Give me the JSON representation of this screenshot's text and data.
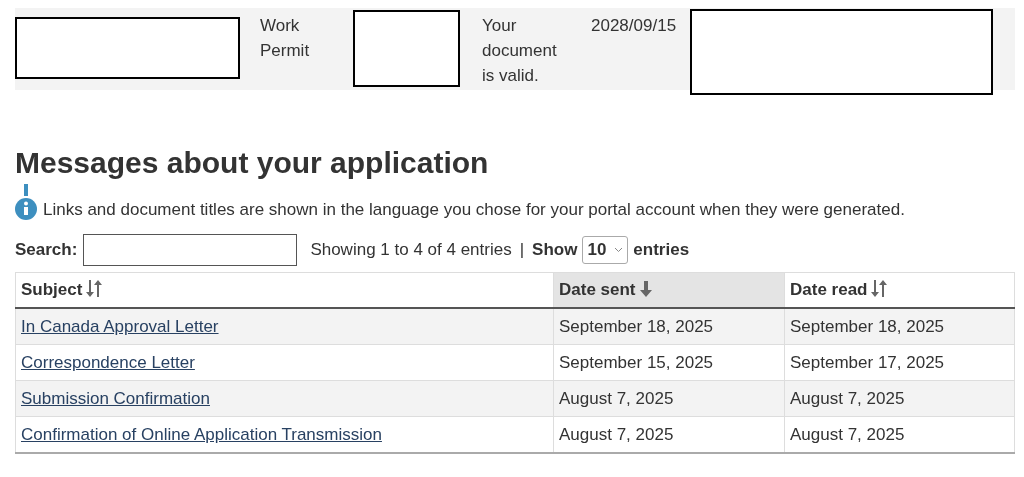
{
  "document_row": [
    {
      "kind": "redacted"
    },
    {
      "kind": "text",
      "text": "Work Permit"
    },
    {
      "kind": "redacted"
    },
    {
      "kind": "text",
      "text": "Your document is valid."
    },
    {
      "kind": "text",
      "text": "2028/09/15"
    },
    {
      "kind": "redacted"
    }
  ],
  "heading": "Messages about your application",
  "notice": "Links and document titles are shown in the language you chose for your portal account when they were generated.",
  "controls": {
    "search_label": "Search:",
    "summary": "Showing 1 to 4 of 4 entries",
    "separator": "|",
    "show_label": "Show",
    "page_size": "10",
    "entries_label": "entries"
  },
  "table": {
    "columns": [
      {
        "label": "Subject",
        "sorted": false,
        "selected": false
      },
      {
        "label": "Date sent",
        "sorted": true,
        "selected": true
      },
      {
        "label": "Date read",
        "sorted": false,
        "selected": false
      }
    ],
    "rows": [
      [
        "In Canada Approval Letter",
        "September 18, 2025",
        "September 18, 2025"
      ],
      [
        "Correspondence Letter",
        "September 15, 2025",
        "September 17, 2025"
      ],
      [
        "Submission Confirmation",
        "August 7, 2025",
        "August 7, 2025"
      ],
      [
        "Confirmation of Online Application Transmission",
        "August 7, 2025",
        "August 7, 2025"
      ]
    ]
  }
}
